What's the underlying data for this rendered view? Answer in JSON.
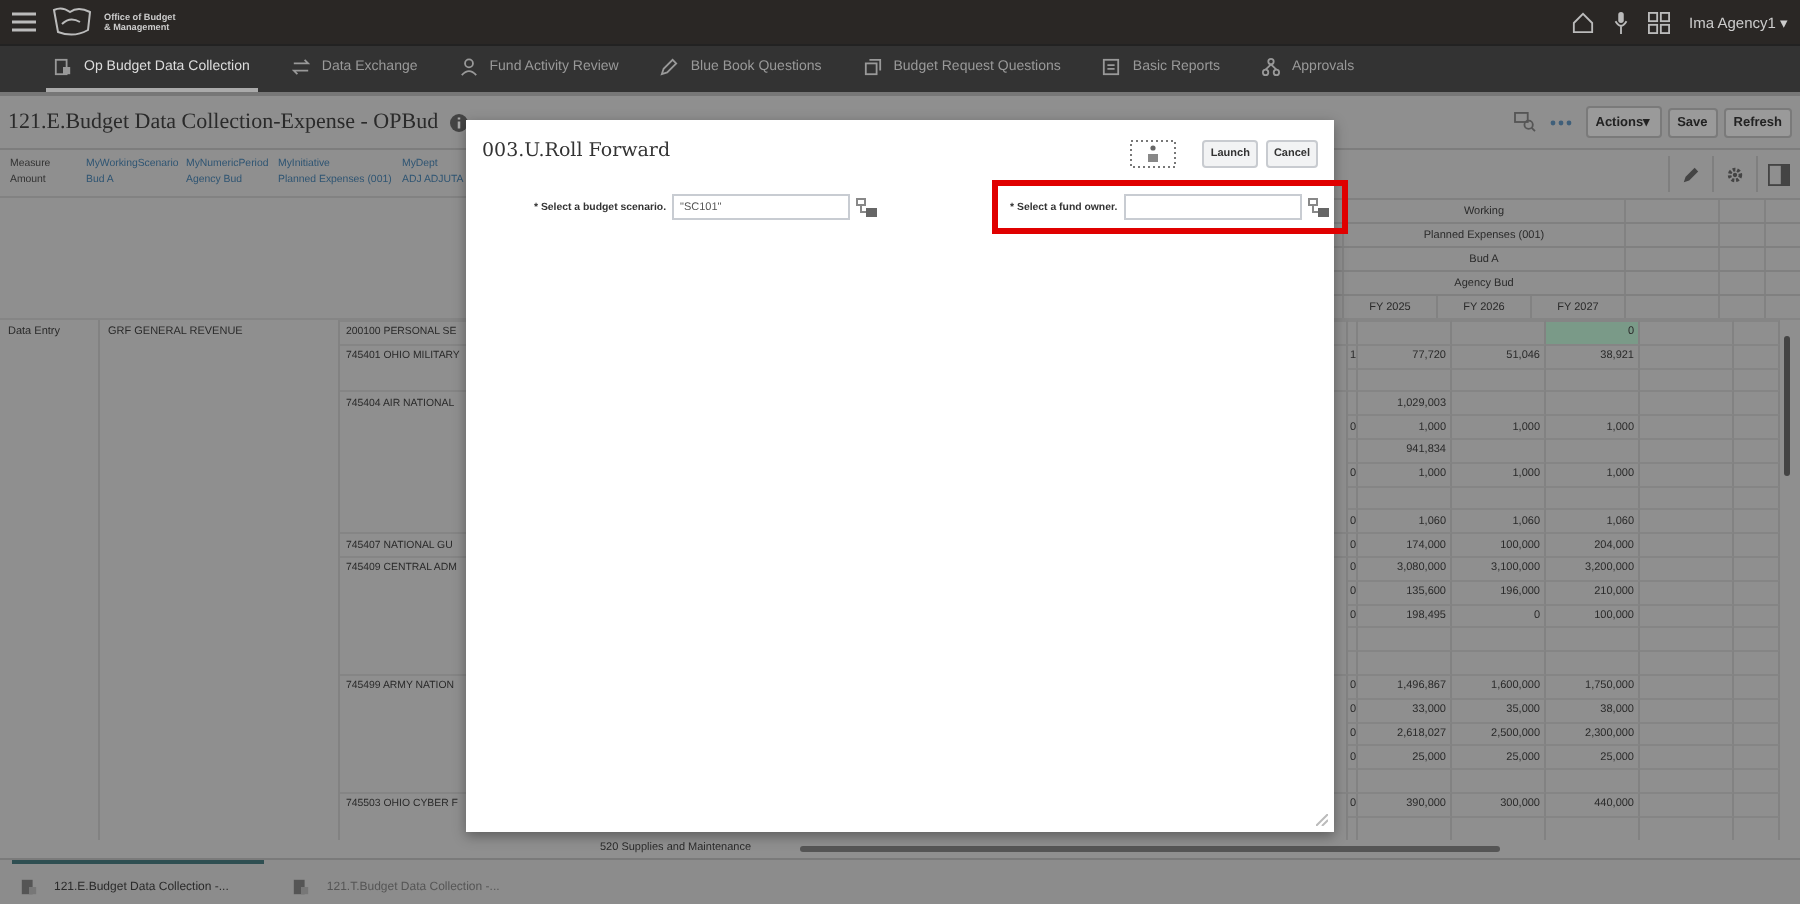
{
  "top_bar": {
    "logo_lines": [
      "Office of Budget",
      "& Management"
    ],
    "user": "Ima Agency1",
    "user_caret": "▾"
  },
  "nav_tabs": [
    {
      "label": "Op Budget Data Collection",
      "selected": true,
      "kind": "form"
    },
    {
      "label": "Data Exchange",
      "selected": false,
      "kind": "exchange"
    },
    {
      "label": "Fund Activity Review",
      "selected": false,
      "kind": "person"
    },
    {
      "label": "Blue Book Questions",
      "selected": false,
      "kind": "pencil"
    },
    {
      "label": "Budget Request Questions",
      "selected": false,
      "kind": "copy"
    },
    {
      "label": "Basic Reports",
      "selected": false,
      "kind": "report"
    },
    {
      "label": "Approvals",
      "selected": false,
      "kind": "tree"
    }
  ],
  "page": {
    "title": "121.E.Budget Data Collection-Expense - OPBud",
    "buttons": [
      {
        "label": "Actions",
        "caret": "▾"
      },
      {
        "label": "Save"
      },
      {
        "label": "Refresh"
      }
    ]
  },
  "pov": [
    {
      "dimension": "Measure",
      "member": "Amount",
      "link": false
    },
    {
      "dimension": "MyWorkingScenario",
      "member": "Bud A",
      "link": true
    },
    {
      "dimension": "MyNumericPeriod",
      "member": "Agency Bud",
      "link": true
    },
    {
      "dimension": "MyInitiative",
      "member": "Planned Expenses (001)",
      "link": true
    },
    {
      "dimension": "MyDept",
      "member": "ADJ ADJUTA",
      "link": true
    }
  ],
  "grid": {
    "header_rows": [
      "Working",
      "Planned Expenses (001)",
      "Bud A",
      "Agency Bud"
    ],
    "columns": [
      "FY 2025",
      "FY 2026",
      "FY 2027"
    ],
    "entry": "Data Entry",
    "fund": "GRF GENERAL REVENUE",
    "rows": [
      {
        "account": "200100 PERSONAL SE",
        "column_3": "0",
        "changed": true
      },
      {
        "account": "745401 OHIO MILITARY",
        "column_0": "1",
        "column_1": "77,720",
        "column_2": "51,046",
        "column_3": "38,921",
        "changed": false
      },
      {
        "changed": false
      },
      {
        "account": "745404 AIR NATIONAL",
        "column_1": "1,029,003",
        "changed": false
      },
      {
        "column_0": "0",
        "column_1": "1,000",
        "column_2": "1,000",
        "column_3": "1,000",
        "changed": false
      },
      {
        "column_1": "941,834",
        "changed": false
      },
      {
        "column_0": "0",
        "column_1": "1,000",
        "column_2": "1,000",
        "column_3": "1,000",
        "changed": false
      },
      {
        "changed": false
      },
      {
        "column_0": "0",
        "column_1": "1,060",
        "column_2": "1,060",
        "column_3": "1,060",
        "changed": false
      },
      {
        "account": "745407 NATIONAL GU",
        "column_0": "0",
        "column_1": "174,000",
        "column_2": "100,000",
        "column_3": "204,000",
        "changed": false
      },
      {
        "account": "745409 CENTRAL ADM",
        "column_0": "0",
        "column_1": "3,080,000",
        "column_2": "3,100,000",
        "column_3": "3,200,000",
        "changed": false
      },
      {
        "column_0": "0",
        "column_1": "135,600",
        "column_2": "196,000",
        "column_3": "210,000",
        "changed": false
      },
      {
        "column_0": "0",
        "column_1": "198,495",
        "column_2": "0",
        "column_3": "100,000",
        "changed": false
      },
      {
        "changed": false
      },
      {
        "changed": false
      },
      {
        "account": "745499 ARMY NATION",
        "column_0": "0",
        "column_1": "1,496,867",
        "column_2": "1,600,000",
        "column_3": "1,750,000",
        "changed": false
      },
      {
        "column_0": "0",
        "column_1": "33,000",
        "column_2": "35,000",
        "column_3": "38,000",
        "changed": false
      },
      {
        "column_0": "0",
        "column_1": "2,618,027",
        "column_2": "2,500,000",
        "column_3": "2,300,000",
        "changed": false
      },
      {
        "column_0": "0",
        "column_1": "25,000",
        "column_2": "25,000",
        "column_3": "25,000",
        "changed": false
      },
      {
        "changed": false
      },
      {
        "account": "745503 OHIO CYBER F",
        "column_0": "0",
        "column_1": "390,000",
        "column_2": "300,000",
        "column_3": "440,000",
        "changed": false
      },
      {
        "changed": false
      }
    ],
    "bottom_partial": "520 Supplies and Maintenance"
  },
  "dialog": {
    "title": "003.U.Roll Forward",
    "buttons": [
      "Launch",
      "Cancel"
    ],
    "fields": [
      {
        "label": "* Select a budget scenario.",
        "value": "\"SC101\"",
        "highlighted": false
      },
      {
        "label": "* Select a fund owner.",
        "highlighted": true
      }
    ]
  },
  "bottom_tabs": [
    {
      "label": "121.E.Budget Data Collection -...",
      "selected": true
    },
    {
      "label": "121.T.Budget Data Collection -...",
      "selected": false
    }
  ]
}
